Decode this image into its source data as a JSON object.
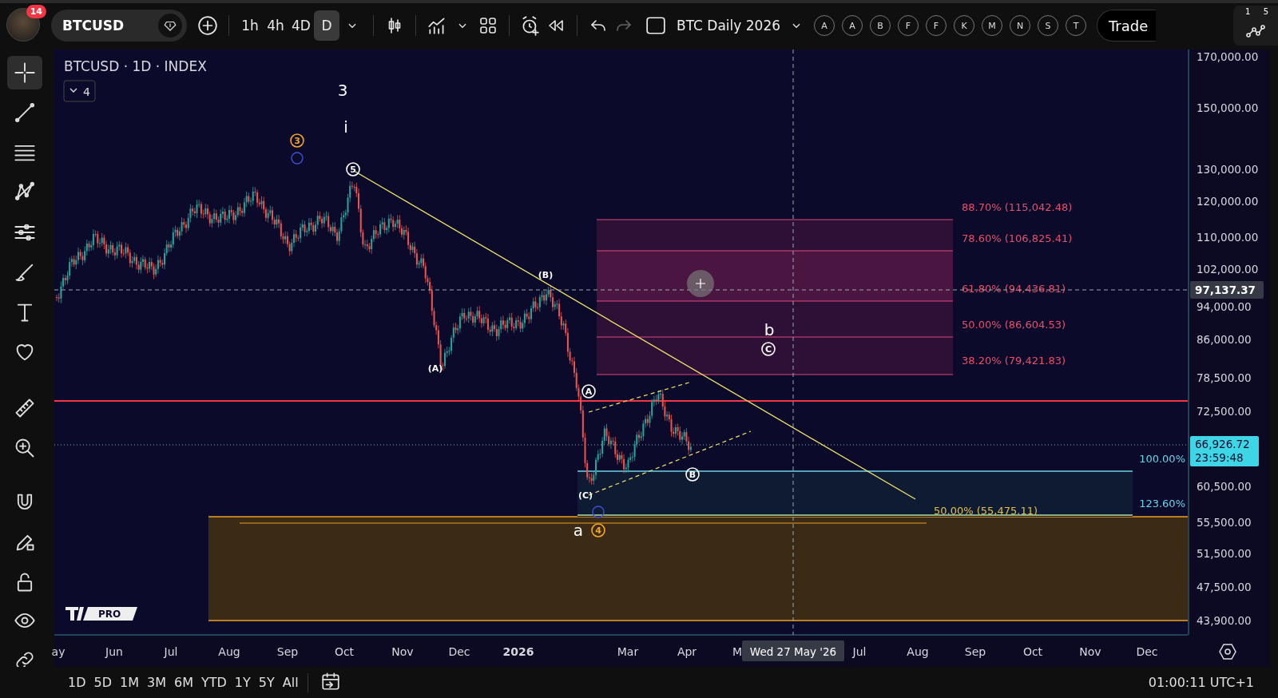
{
  "toolbar": {
    "notification_count": "14",
    "symbol": "BTCUSD",
    "intervals": [
      {
        "label": "1h",
        "selected": false
      },
      {
        "label": "4h",
        "selected": false
      },
      {
        "label": "4D",
        "selected": false
      },
      {
        "label": "D",
        "selected": true
      }
    ],
    "undo": {
      "disabled": false
    },
    "redo": {
      "disabled": true
    },
    "layout_toggle": {
      "checked": false
    },
    "layout_name": "BTC Daily 2026",
    "user_badges": [
      "A",
      "A",
      "B",
      "F",
      "F",
      "K",
      "M",
      "N",
      "S",
      "T"
    ],
    "trade_button": "Trade",
    "network_digits": [
      "1",
      "5"
    ]
  },
  "left_toolbar": {
    "tools": [
      {
        "kind": "crosshair",
        "selected": true
      },
      {
        "kind": "trendline",
        "selected": false
      },
      {
        "kind": "fib",
        "selected": false
      },
      {
        "kind": "pattern",
        "selected": false
      },
      {
        "kind": "projection",
        "selected": false
      },
      {
        "kind": "brush",
        "selected": false
      },
      {
        "kind": "text",
        "selected": false
      },
      {
        "kind": "heart",
        "selected": false
      },
      {
        "kind": "ruler",
        "selected": false
      },
      {
        "kind": "zoom",
        "selected": false
      },
      {
        "kind": "magnet",
        "selected": false
      },
      {
        "kind": "pencil",
        "selected": false
      },
      {
        "kind": "lock",
        "selected": false
      },
      {
        "kind": "eye",
        "selected": false
      },
      {
        "kind": "link",
        "selected": false
      }
    ]
  },
  "chart": {
    "title": "BTCUSD · 1D · INDEX",
    "collapsed_count": "4",
    "wave_labels": [
      {
        "kind": "large",
        "text": "3",
        "color": "#ffffff"
      },
      {
        "kind": "large",
        "text": "i",
        "color": "#ffffff"
      },
      {
        "kind": "circled",
        "text": "3",
        "color": "#f5a623"
      },
      {
        "kind": "ring",
        "color": "#3f51d6"
      },
      {
        "kind": "circled",
        "text": "5",
        "color": "#ffffff"
      },
      {
        "kind": "small",
        "text": "(B)",
        "color": "#ffffff"
      },
      {
        "kind": "small",
        "text": "(A)",
        "color": "#ffffff"
      },
      {
        "kind": "circled",
        "text": "A",
        "color": "#ffffff"
      },
      {
        "kind": "small",
        "text": "(C)",
        "color": "#ffffff"
      },
      {
        "kind": "circled",
        "text": "B",
        "color": "#ffffff"
      },
      {
        "kind": "large",
        "text": "b",
        "color": "#ffffff"
      },
      {
        "kind": "circled",
        "text": "C",
        "color": "#ffffff"
      },
      {
        "kind": "large",
        "text": "a",
        "color": "#ffffff"
      },
      {
        "kind": "circled",
        "text": "4",
        "color": "#f5a623"
      },
      {
        "kind": "ring",
        "color": "#3f51d6"
      }
    ],
    "fib_levels": [
      "88.70% (115,042.48)",
      "78.60% (106,825.41)",
      "61.80% (94,436.81)",
      "50.00% (86,604.53)",
      "38.20% (79,421.83)"
    ],
    "extension_levels": [
      "100.00%",
      "123.60%"
    ],
    "support_label": "50.00% (55,475.11)",
    "logo_text": "PRO"
  },
  "price_axis": {
    "labels": [
      "170,000.00",
      "150,000.00",
      "130,000.00",
      "120,000.00",
      "110,000.00",
      "102,000.00",
      "94,000.00",
      "86,000.00",
      "78,500.00",
      "72,500.00",
      "60,500.00",
      "55,500.00",
      "51,500.00",
      "47,500.00",
      "43,900.00"
    ],
    "crosshair_price": "97,137.37",
    "last_price": "66,926.72",
    "countdown": "23:59:48"
  },
  "time_axis": {
    "labels": [
      {
        "text": "ay",
        "kind": "month"
      },
      {
        "text": "Jun",
        "kind": "month"
      },
      {
        "text": "Jul",
        "kind": "month"
      },
      {
        "text": "Aug",
        "kind": "month"
      },
      {
        "text": "Sep",
        "kind": "month"
      },
      {
        "text": "Oct",
        "kind": "month"
      },
      {
        "text": "Nov",
        "kind": "month"
      },
      {
        "text": "Dec",
        "kind": "month"
      },
      {
        "text": "2026",
        "kind": "year"
      },
      {
        "text": "Mar",
        "kind": "month"
      },
      {
        "text": "Apr",
        "kind": "month"
      },
      {
        "text": "M",
        "kind": "month"
      },
      {
        "text": "Jul",
        "kind": "month"
      },
      {
        "text": "Aug",
        "kind": "month"
      },
      {
        "text": "Sep",
        "kind": "month"
      },
      {
        "text": "Oct",
        "kind": "month"
      },
      {
        "text": "Nov",
        "kind": "month"
      },
      {
        "text": "Dec",
        "kind": "month"
      }
    ],
    "crosshair_date": "Wed 27 May '26"
  },
  "bottom_bar": {
    "ranges": [
      "1D",
      "5D",
      "1M",
      "3M",
      "6M",
      "YTD",
      "1Y",
      "5Y",
      "All"
    ],
    "clock": "01:00:11 UTC+1"
  }
}
